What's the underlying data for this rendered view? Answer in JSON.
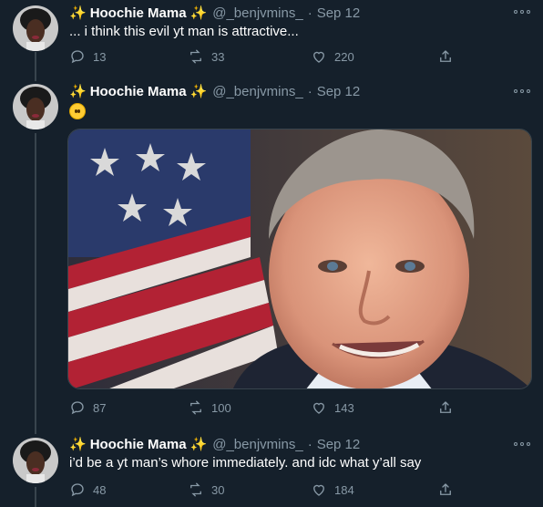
{
  "tweets": [
    {
      "display_name": "Hoochie Mama",
      "handle": "@_benjvmins_",
      "date": "Sep 12",
      "text": "... i think this evil yt man is attractive...",
      "replies": "13",
      "retweets": "33",
      "likes": "220"
    },
    {
      "display_name": "Hoochie Mama",
      "handle": "@_benjvmins_",
      "date": "Sep 12",
      "emoji": "flushed-face-icon",
      "replies": "87",
      "retweets": "100",
      "likes": "143"
    },
    {
      "display_name": "Hoochie Mama",
      "handle": "@_benjvmins_",
      "date": "Sep 12",
      "text": "i’d be a yt man’s whore immediately. and idc what y’all say",
      "replies": "48",
      "retweets": "30",
      "likes": "184"
    }
  ],
  "colors": {
    "background": "#15202b",
    "secondary_text": "#8899a6",
    "sparkle": "#ffd34d"
  }
}
